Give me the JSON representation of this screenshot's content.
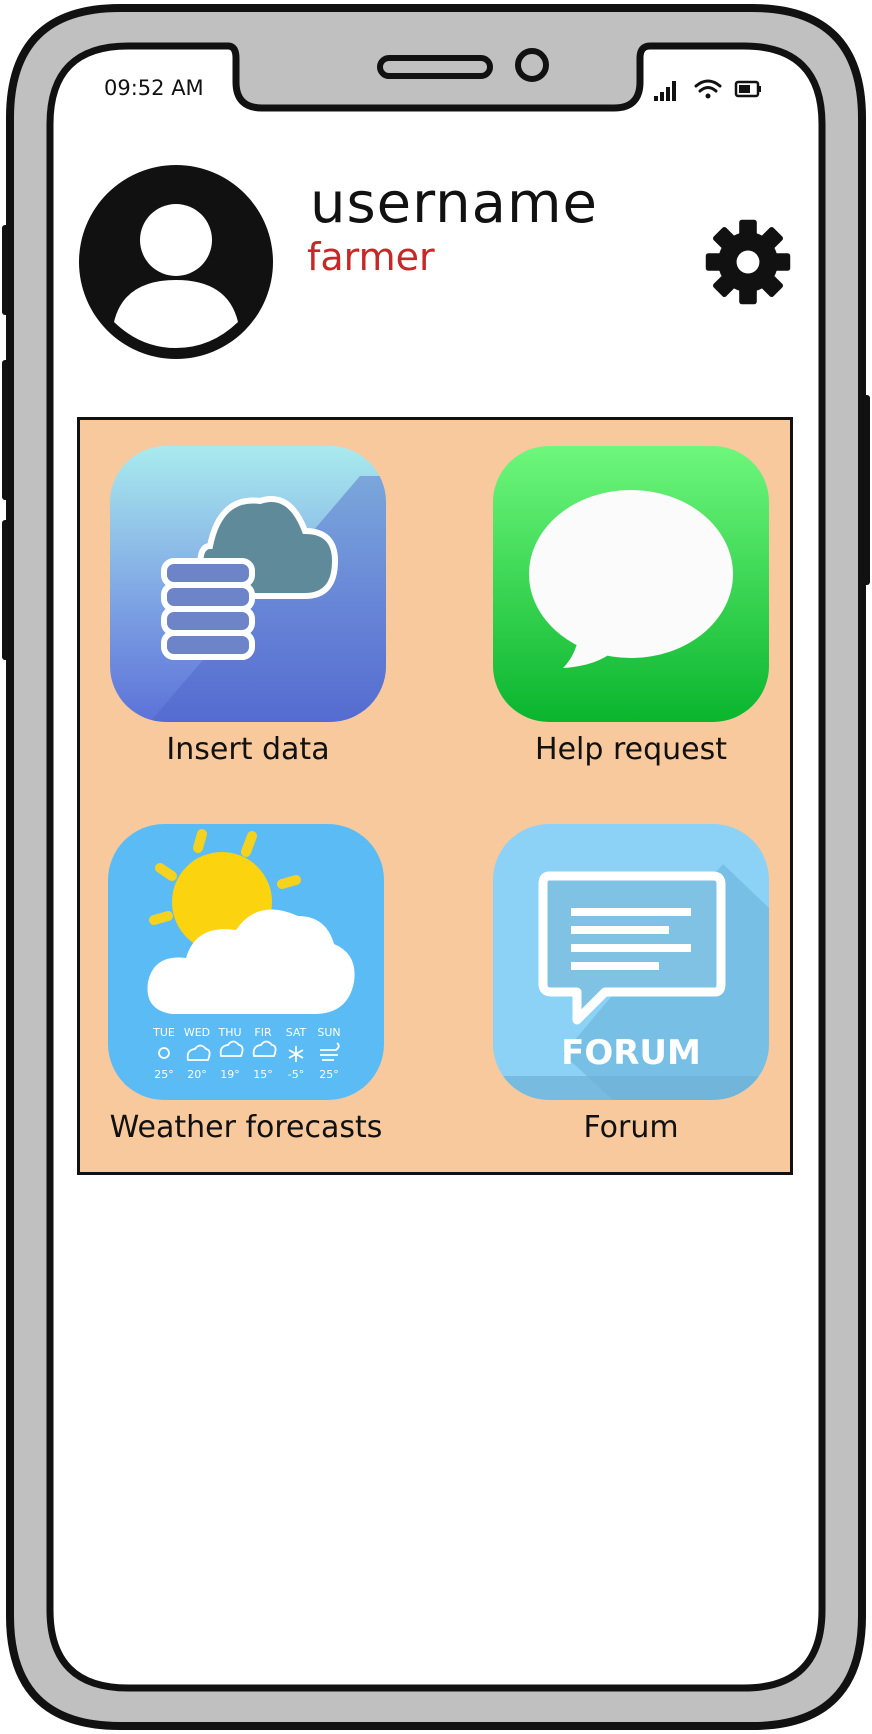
{
  "status_bar": {
    "time": "09:52 AM"
  },
  "profile": {
    "username": "username",
    "role": "farmer"
  },
  "apps": [
    {
      "label": "Insert data",
      "icon": "cloud-database-icon"
    },
    {
      "label": "Help request",
      "icon": "message-bubble-icon"
    },
    {
      "label": "Weather forecasts",
      "icon": "weather-icon"
    },
    {
      "label": "Forum",
      "icon": "forum-icon"
    }
  ],
  "weather_widget": {
    "days": [
      {
        "day": "TUE",
        "temp": "25°"
      },
      {
        "day": "WED",
        "temp": "20°"
      },
      {
        "day": "THU",
        "temp": "19°"
      },
      {
        "day": "FIR",
        "temp": "15°"
      },
      {
        "day": "SAT",
        "temp": "-5°"
      },
      {
        "day": "SUN",
        "temp": "25°"
      }
    ]
  },
  "forum_icon_text": "FORUM",
  "colors": {
    "panel": "#f8c99c",
    "role": "#c62828",
    "help_green": "#2ed158",
    "weather_blue": "#5bbcf5",
    "forum_blue": "#7cc3ea"
  }
}
